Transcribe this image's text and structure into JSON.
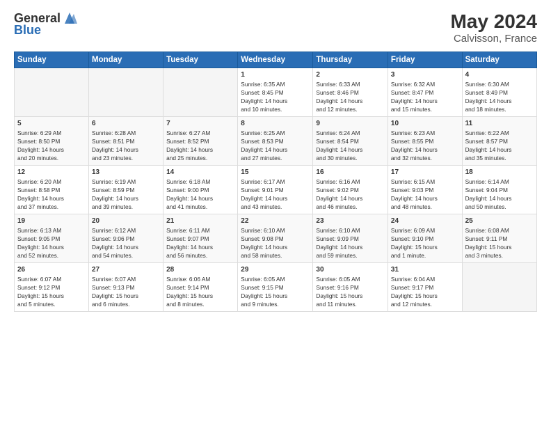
{
  "header": {
    "logo_general": "General",
    "logo_blue": "Blue",
    "month": "May 2024",
    "location": "Calvisson, France"
  },
  "weekdays": [
    "Sunday",
    "Monday",
    "Tuesday",
    "Wednesday",
    "Thursday",
    "Friday",
    "Saturday"
  ],
  "weeks": [
    [
      {
        "day": "",
        "info": ""
      },
      {
        "day": "",
        "info": ""
      },
      {
        "day": "",
        "info": ""
      },
      {
        "day": "1",
        "info": "Sunrise: 6:35 AM\nSunset: 8:45 PM\nDaylight: 14 hours\nand 10 minutes."
      },
      {
        "day": "2",
        "info": "Sunrise: 6:33 AM\nSunset: 8:46 PM\nDaylight: 14 hours\nand 12 minutes."
      },
      {
        "day": "3",
        "info": "Sunrise: 6:32 AM\nSunset: 8:47 PM\nDaylight: 14 hours\nand 15 minutes."
      },
      {
        "day": "4",
        "info": "Sunrise: 6:30 AM\nSunset: 8:49 PM\nDaylight: 14 hours\nand 18 minutes."
      }
    ],
    [
      {
        "day": "5",
        "info": "Sunrise: 6:29 AM\nSunset: 8:50 PM\nDaylight: 14 hours\nand 20 minutes."
      },
      {
        "day": "6",
        "info": "Sunrise: 6:28 AM\nSunset: 8:51 PM\nDaylight: 14 hours\nand 23 minutes."
      },
      {
        "day": "7",
        "info": "Sunrise: 6:27 AM\nSunset: 8:52 PM\nDaylight: 14 hours\nand 25 minutes."
      },
      {
        "day": "8",
        "info": "Sunrise: 6:25 AM\nSunset: 8:53 PM\nDaylight: 14 hours\nand 27 minutes."
      },
      {
        "day": "9",
        "info": "Sunrise: 6:24 AM\nSunset: 8:54 PM\nDaylight: 14 hours\nand 30 minutes."
      },
      {
        "day": "10",
        "info": "Sunrise: 6:23 AM\nSunset: 8:55 PM\nDaylight: 14 hours\nand 32 minutes."
      },
      {
        "day": "11",
        "info": "Sunrise: 6:22 AM\nSunset: 8:57 PM\nDaylight: 14 hours\nand 35 minutes."
      }
    ],
    [
      {
        "day": "12",
        "info": "Sunrise: 6:20 AM\nSunset: 8:58 PM\nDaylight: 14 hours\nand 37 minutes."
      },
      {
        "day": "13",
        "info": "Sunrise: 6:19 AM\nSunset: 8:59 PM\nDaylight: 14 hours\nand 39 minutes."
      },
      {
        "day": "14",
        "info": "Sunrise: 6:18 AM\nSunset: 9:00 PM\nDaylight: 14 hours\nand 41 minutes."
      },
      {
        "day": "15",
        "info": "Sunrise: 6:17 AM\nSunset: 9:01 PM\nDaylight: 14 hours\nand 43 minutes."
      },
      {
        "day": "16",
        "info": "Sunrise: 6:16 AM\nSunset: 9:02 PM\nDaylight: 14 hours\nand 46 minutes."
      },
      {
        "day": "17",
        "info": "Sunrise: 6:15 AM\nSunset: 9:03 PM\nDaylight: 14 hours\nand 48 minutes."
      },
      {
        "day": "18",
        "info": "Sunrise: 6:14 AM\nSunset: 9:04 PM\nDaylight: 14 hours\nand 50 minutes."
      }
    ],
    [
      {
        "day": "19",
        "info": "Sunrise: 6:13 AM\nSunset: 9:05 PM\nDaylight: 14 hours\nand 52 minutes."
      },
      {
        "day": "20",
        "info": "Sunrise: 6:12 AM\nSunset: 9:06 PM\nDaylight: 14 hours\nand 54 minutes."
      },
      {
        "day": "21",
        "info": "Sunrise: 6:11 AM\nSunset: 9:07 PM\nDaylight: 14 hours\nand 56 minutes."
      },
      {
        "day": "22",
        "info": "Sunrise: 6:10 AM\nSunset: 9:08 PM\nDaylight: 14 hours\nand 58 minutes."
      },
      {
        "day": "23",
        "info": "Sunrise: 6:10 AM\nSunset: 9:09 PM\nDaylight: 14 hours\nand 59 minutes."
      },
      {
        "day": "24",
        "info": "Sunrise: 6:09 AM\nSunset: 9:10 PM\nDaylight: 15 hours\nand 1 minute."
      },
      {
        "day": "25",
        "info": "Sunrise: 6:08 AM\nSunset: 9:11 PM\nDaylight: 15 hours\nand 3 minutes."
      }
    ],
    [
      {
        "day": "26",
        "info": "Sunrise: 6:07 AM\nSunset: 9:12 PM\nDaylight: 15 hours\nand 5 minutes."
      },
      {
        "day": "27",
        "info": "Sunrise: 6:07 AM\nSunset: 9:13 PM\nDaylight: 15 hours\nand 6 minutes."
      },
      {
        "day": "28",
        "info": "Sunrise: 6:06 AM\nSunset: 9:14 PM\nDaylight: 15 hours\nand 8 minutes."
      },
      {
        "day": "29",
        "info": "Sunrise: 6:05 AM\nSunset: 9:15 PM\nDaylight: 15 hours\nand 9 minutes."
      },
      {
        "day": "30",
        "info": "Sunrise: 6:05 AM\nSunset: 9:16 PM\nDaylight: 15 hours\nand 11 minutes."
      },
      {
        "day": "31",
        "info": "Sunrise: 6:04 AM\nSunset: 9:17 PM\nDaylight: 15 hours\nand 12 minutes."
      },
      {
        "day": "",
        "info": ""
      }
    ]
  ]
}
